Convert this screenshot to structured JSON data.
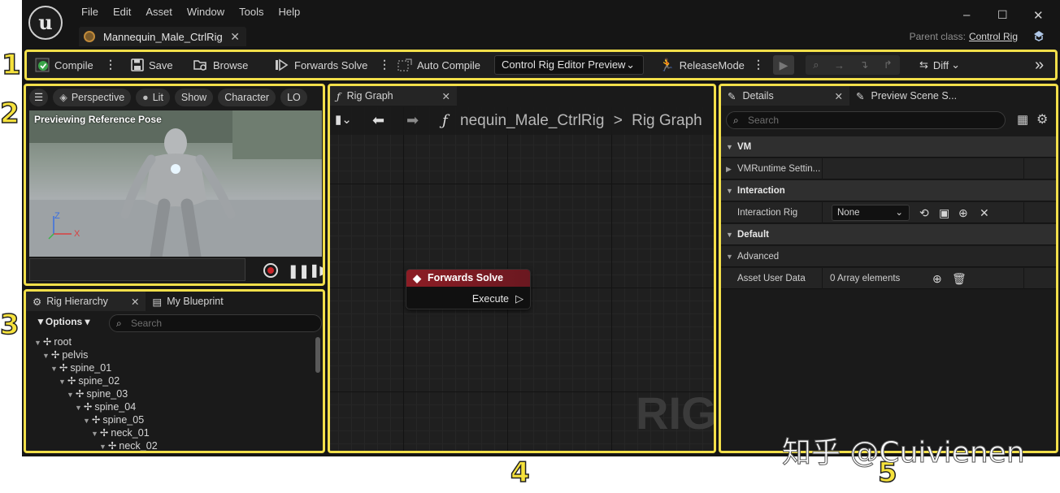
{
  "app": {
    "logo": "u",
    "menu": [
      "File",
      "Edit",
      "Asset",
      "Window",
      "Tools",
      "Help"
    ],
    "doc_tab": "Mannequin_Male_CtrlRig",
    "window_controls": [
      "–",
      "☐",
      "✕"
    ],
    "parent_class_label": "Parent class:",
    "parent_class_value": "Control Rig"
  },
  "toolbar": {
    "compile": "Compile",
    "save": "Save",
    "browse": "Browse",
    "forwards_solve": "Forwards Solve",
    "auto_compile": "Auto Compile",
    "preview_mode": "Control Rig Editor Preview",
    "release_mode": "ReleaseMode",
    "diff": "Diff",
    "overflow": "»"
  },
  "viewport": {
    "pills": [
      "Perspective",
      "Lit",
      "Show",
      "Character",
      "LO"
    ],
    "overlay_text": "Previewing Reference Pose",
    "axis_z": "Z",
    "axis_x": "X"
  },
  "hierarchy": {
    "tabs": [
      "Rig Hierarchy",
      "My Blueprint"
    ],
    "options": "Options",
    "search_placeholder": "Search",
    "bones": [
      "root",
      "pelvis",
      "spine_01",
      "spine_02",
      "spine_03",
      "spine_04",
      "spine_05",
      "neck_01",
      "neck_02"
    ]
  },
  "graph": {
    "tab": "Rig Graph",
    "breadcrumb_asset": "nequin_Male_CtrlRig",
    "breadcrumb_sep": ">",
    "breadcrumb_graph": "Rig Graph",
    "node_title": "Forwards Solve",
    "node_pin": "Execute",
    "watermark": "RIG"
  },
  "details": {
    "tabs": [
      "Details",
      "Preview Scene S..."
    ],
    "search_placeholder": "Search",
    "sections": {
      "vm": "VM",
      "vm_runtime": "VMRuntime Settin...",
      "interaction": "Interaction",
      "interaction_rig": "Interaction Rig",
      "interaction_rig_value": "None",
      "default": "Default",
      "advanced": "Advanced",
      "asset_user_data": "Asset User Data",
      "asset_user_data_value": "0 Array elements"
    }
  },
  "annotations": [
    "1",
    "2",
    "3",
    "4",
    "5"
  ],
  "watermark_text": "知乎 @Cuivienen",
  "colors": {
    "highlight": "#f2df4a",
    "node_header": "#8c1d25",
    "panel_bg": "#1a1a1a"
  }
}
